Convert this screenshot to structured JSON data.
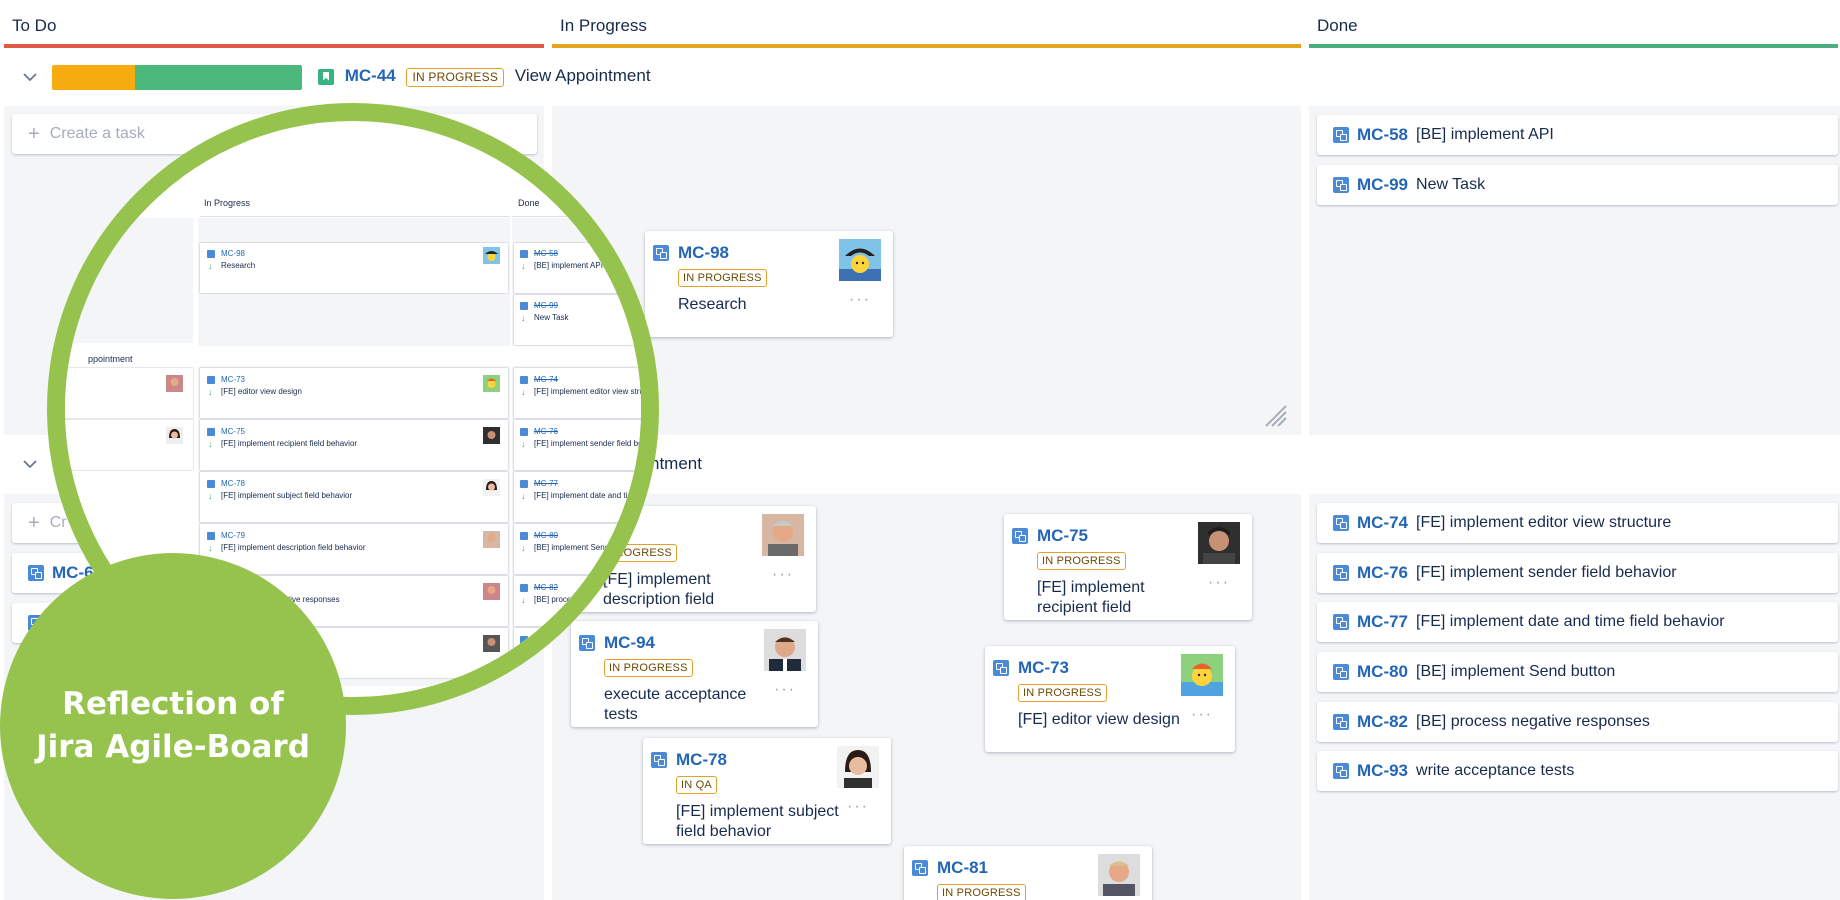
{
  "columns": [
    {
      "title": "To Do",
      "color": "#de5b43"
    },
    {
      "title": "In Progress",
      "color": "#e3a51c"
    },
    {
      "title": "Done",
      "color": "#4bae7c"
    }
  ],
  "swimlane1": {
    "key": "MC-44",
    "status": "IN PROGRESS",
    "title": "View Appointment",
    "create_label": "Create a task",
    "done": [
      {
        "key": "MC-58",
        "summary": "[BE] implement API"
      },
      {
        "key": "MC-99",
        "summary": "New Task"
      }
    ],
    "card": {
      "key": "MC-98",
      "status": "IN PROGRESS",
      "summary": "Research",
      "dots": "···"
    }
  },
  "swimlane2": {
    "title": "ntment",
    "create_label": "Cr",
    "todo_keys": [
      "MC-6",
      ""
    ],
    "done": [
      {
        "key": "MC-74",
        "summary": "[FE] implement editor view structure"
      },
      {
        "key": "MC-76",
        "summary": "[FE] implement sender field behavior"
      },
      {
        "key": "MC-77",
        "summary": "[FE] implement date and time field behavior"
      },
      {
        "key": "MC-80",
        "summary": "[BE] implement Send button"
      },
      {
        "key": "MC-82",
        "summary": "[BE] process negative responses"
      },
      {
        "key": "MC-93",
        "summary": "write acceptance tests"
      }
    ],
    "cards": [
      {
        "key": "79",
        "status": "PROGRESS",
        "summary": "[FE] implement description field",
        "dots": "···"
      },
      {
        "key": "MC-75",
        "status": "IN PROGRESS",
        "summary": "[FE] implement recipient field",
        "dots": "···"
      },
      {
        "key": "MC-94",
        "status": "IN PROGRESS",
        "summary": "execute acceptance tests",
        "dots": "···"
      },
      {
        "key": "MC-73",
        "status": "IN PROGRESS",
        "summary": "[FE] editor view design",
        "dots": "···"
      },
      {
        "key": "MC-78",
        "status": "IN QA",
        "summary": "[FE] implement subject field behavior",
        "dots": "···"
      },
      {
        "key": "MC-81",
        "status": "IN PROGRESS",
        "summary": "",
        "dots": ""
      }
    ]
  },
  "mini_board": {
    "col_in_progress": "In Progress",
    "col_done": "Done",
    "lane_label": "ppointment",
    "in_progress": [
      {
        "key": "MC-98",
        "summary": "Research"
      },
      {
        "key": "MC-73",
        "summary": "[FE] editor view design"
      },
      {
        "key": "MC-75",
        "summary": "[FE] implement recipient field behavior"
      },
      {
        "key": "MC-78",
        "summary": "[FE] implement subject field behavior"
      },
      {
        "key": "MC-79",
        "summary": "[FE] implement description field behavior"
      },
      {
        "key": "",
        "summary": "tive responses"
      }
    ],
    "done": [
      {
        "key": "MC-58",
        "summary": "[BE] implement API"
      },
      {
        "key": "MC-99",
        "summary": "New Task"
      },
      {
        "key": "MC-74",
        "summary": "[FE] implement editor view structu"
      },
      {
        "key": "MC-76",
        "summary": "[FE] implement sender field behav"
      },
      {
        "key": "MC-77",
        "summary": "[FE] implement date and time fie"
      },
      {
        "key": "MC-80",
        "summary": "[BE] implement Send butto"
      },
      {
        "key": "MC-82",
        "summary": "[BE] process negat"
      },
      {
        "key": "MC-93",
        "summary": "write"
      }
    ]
  },
  "overlay": {
    "line1": "Reflection of",
    "line2": "Jira Agile-Board",
    "color": "#95c34d"
  }
}
